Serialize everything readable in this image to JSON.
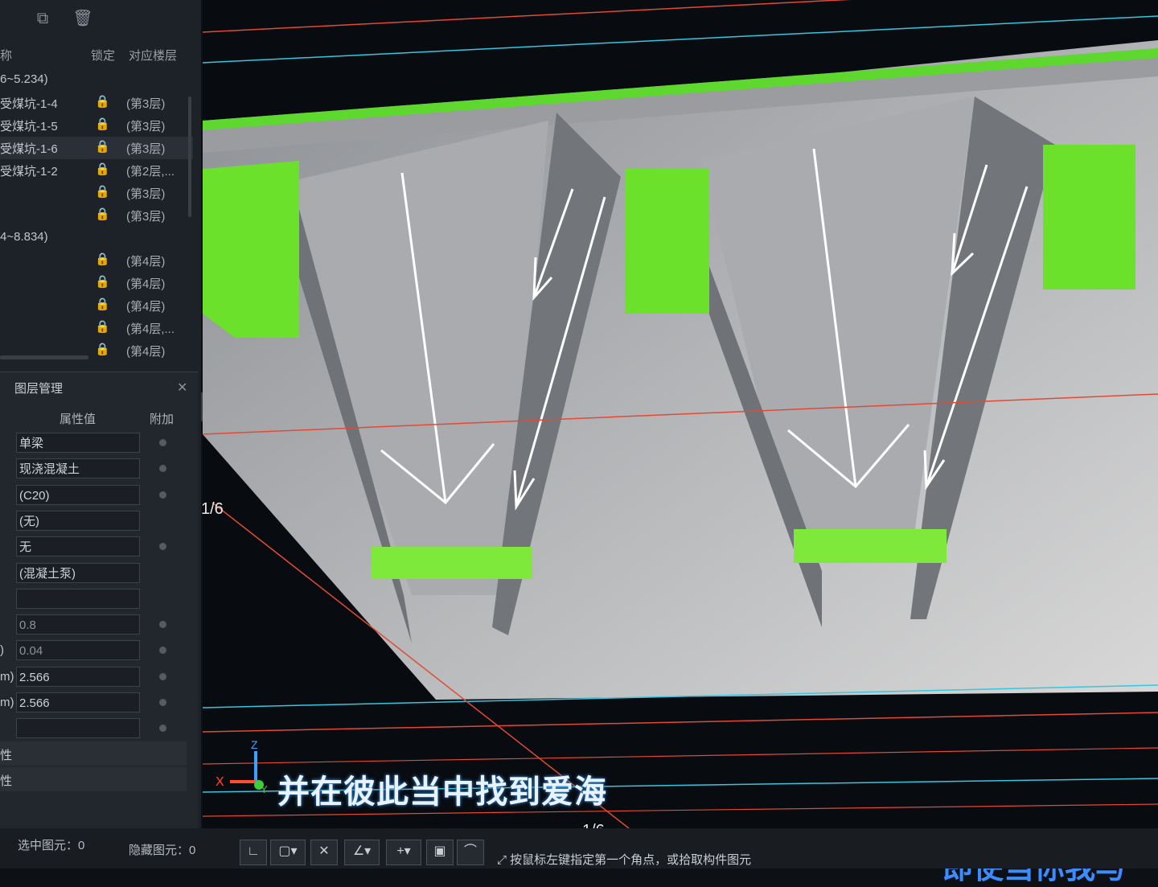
{
  "toolbar": {
    "icons": [
      "copy-icon",
      "delete-icon"
    ]
  },
  "tree": {
    "col_name": "称",
    "col_lock": "锁定",
    "col_floor": "对应楼层",
    "rows": [
      {
        "name": "6~5.234)",
        "floor": "",
        "lock": false
      },
      {
        "name": "受煤坑-1-4",
        "floor": "(第3层)",
        "lock": true
      },
      {
        "name": "受煤坑-1-5",
        "floor": "(第3层)",
        "lock": true
      },
      {
        "name": "受煤坑-1-6",
        "floor": "(第3层)",
        "lock": true,
        "selected": true
      },
      {
        "name": "受煤坑-1-2",
        "floor": "(第2层,...",
        "lock": true
      },
      {
        "name": "",
        "floor": "(第3层)",
        "lock": true
      },
      {
        "name": "",
        "floor": "(第3层)",
        "lock": true
      },
      {
        "name": "4~8.834)",
        "floor": "",
        "lock": false
      },
      {
        "name": "",
        "floor": "(第4层)",
        "lock": true
      },
      {
        "name": "",
        "floor": "(第4层)",
        "lock": true
      },
      {
        "name": "",
        "floor": "(第4层)",
        "lock": true
      },
      {
        "name": "",
        "floor": "(第4层,...",
        "lock": true
      },
      {
        "name": "",
        "floor": "(第4层)",
        "lock": true
      }
    ]
  },
  "properties": {
    "tab_title": "图层管理",
    "col_value": "属性值",
    "col_extra": "附加",
    "rows": [
      {
        "label": "",
        "value": "单梁",
        "dot": true
      },
      {
        "label": "",
        "value": "现浇混凝土",
        "dot": true
      },
      {
        "label": "",
        "value": "(C20)",
        "dot": true
      },
      {
        "label": "",
        "value": "(无)",
        "dot": false
      },
      {
        "label": "",
        "value": "无",
        "dot": true
      },
      {
        "label": "",
        "value": "(混凝土泵)",
        "dot": false
      },
      {
        "label": "",
        "value": "",
        "dot": false
      },
      {
        "label": "",
        "value": "0.8",
        "dot": true,
        "muted": true
      },
      {
        "label": ")",
        "value": "0.04",
        "dot": true,
        "muted": true
      },
      {
        "label": "m)",
        "value": "2.566",
        "dot": true
      },
      {
        "label": "m)",
        "value": "2.566",
        "dot": true
      },
      {
        "label": "",
        "value": "",
        "dot": true
      }
    ],
    "groups": [
      "性",
      "性"
    ]
  },
  "status": {
    "selected": "选中图元：0",
    "hidden": "隐藏图元：0",
    "hint": "按鼠标左键指定第一个角点，或拾取构件图元"
  },
  "viewport": {
    "page_tag_1": "1/6",
    "page_tag_2": "1/6",
    "subtitle": "并在彼此当中找到爱海",
    "subtitle2": "即使当你我与",
    "axis_x": "X",
    "axis_y": "Y",
    "axis_z": "Z"
  },
  "colors": {
    "beam": "#7ee83b",
    "concrete": "#b8b8b8",
    "accent": "#3d8cff"
  }
}
